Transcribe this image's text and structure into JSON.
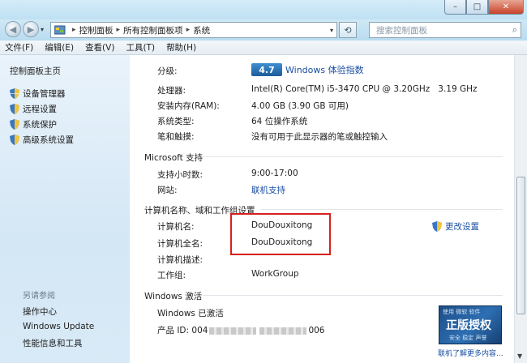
{
  "window": {
    "min_icon": "minimize-icon",
    "max_icon": "maximize-icon",
    "close_icon": "close-icon",
    "min_glyph": "–",
    "max_glyph": "□",
    "close_glyph": "✕"
  },
  "nav": {
    "back_glyph": "◀",
    "forward_glyph": "▶",
    "dropdown_glyph": "▾"
  },
  "address": {
    "breadcrumb": [
      "控制面板",
      "所有控制面板项",
      "系统"
    ],
    "separator": "▸",
    "refresh_glyph": "⟲"
  },
  "search": {
    "placeholder": "搜索控制面板",
    "icon_glyph": "⌕"
  },
  "menu": [
    "文件(F)",
    "编辑(E)",
    "查看(V)",
    "工具(T)",
    "帮助(H)"
  ],
  "sidebar": {
    "home": "控制面板主页",
    "tasks": [
      "设备管理器",
      "远程设置",
      "系统保护",
      "高级系统设置"
    ],
    "see_also_title": "另请参阅",
    "see_also": [
      "操作中心",
      "Windows Update",
      "性能信息和工具"
    ]
  },
  "system": {
    "rating_label": "分级:",
    "rating_score": "4.7",
    "rating_link": "Windows 体验指数",
    "rows": [
      {
        "label": "处理器:",
        "value": "Intel(R) Core(TM) i5-3470 CPU @ 3.20GHz   3.19 GHz"
      },
      {
        "label": "安装内存(RAM):",
        "value": "4.00 GB (3.90 GB 可用)"
      },
      {
        "label": "系统类型:",
        "value": "64 位操作系统"
      },
      {
        "label": "笔和触摸:",
        "value": "没有可用于此显示器的笔或触控输入"
      }
    ]
  },
  "support": {
    "title": "Microsoft 支持",
    "hours_label": "支持小时数:",
    "hours_value": "9:00-17:00",
    "website_label": "网站:",
    "website_value": "联机支持"
  },
  "computer": {
    "title": "计算机名称、域和工作组设置",
    "name_label": "计算机名:",
    "name_value": "DouDouxitong",
    "fullname_label": "计算机全名:",
    "fullname_value": "DouDouxitong",
    "desc_label": "计算机描述:",
    "workgroup_label": "工作组:",
    "workgroup_value": "WorkGroup",
    "change_settings": "更改设置"
  },
  "activation": {
    "title": "Windows 激活",
    "status": "Windows 已激活",
    "product_id_label": "产品 ID: 004",
    "product_id_tail": "006",
    "genuine_top": "使用 微软 软件",
    "genuine_main": "正版授权",
    "genuine_bottom": "安全 稳定 声誉",
    "genuine_link": "联机了解更多内容..."
  },
  "colors": {
    "accent_link": "#1a4fa3",
    "highlight_box": "#d72020"
  }
}
